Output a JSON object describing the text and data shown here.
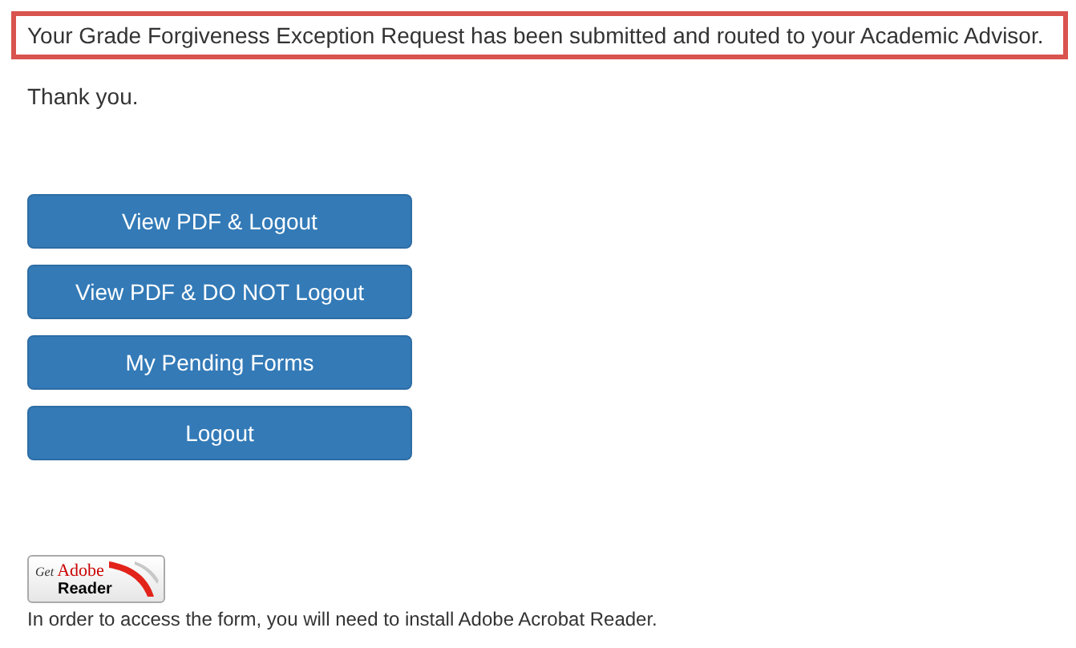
{
  "notice": {
    "message": "Your Grade Forgiveness Exception Request has been submitted and routed to your Academic Advisor."
  },
  "thanks": "Thank you.",
  "buttons": [
    "View PDF & Logout",
    "View PDF & DO NOT Logout",
    "My Pending Forms",
    "Logout"
  ],
  "reader_badge": {
    "get": "Get",
    "brand": "Adobe",
    "product": "Reader"
  },
  "reader_note": "In order to access the form, you will need to install Adobe Acrobat Reader."
}
